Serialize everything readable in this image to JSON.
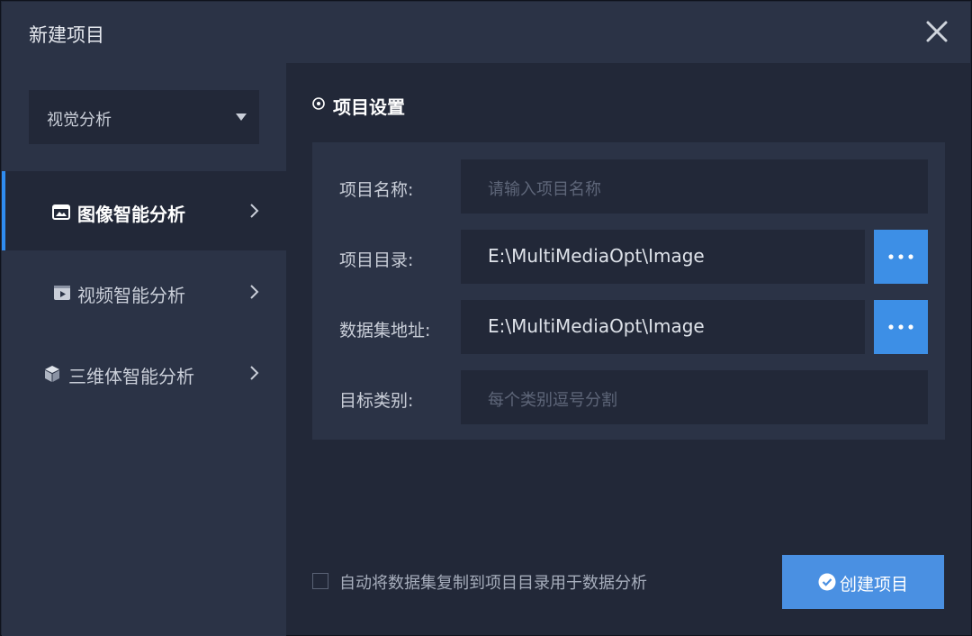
{
  "window": {
    "title": "新建项目"
  },
  "sidebar": {
    "category_select": "视觉分析",
    "items": [
      {
        "label": "图像智能分析",
        "active": true
      },
      {
        "label": "视频智能分析",
        "active": false
      },
      {
        "label": "三维体智能分析",
        "active": false
      }
    ]
  },
  "main": {
    "section_title": "项目设置",
    "fields": {
      "project_name": {
        "label": "项目名称:",
        "value": "",
        "placeholder": "请输入项目名称"
      },
      "project_dir": {
        "label": "项目目录:",
        "value": "E:\\MultiMediaOpt\\Image"
      },
      "dataset_path": {
        "label": "数据集地址:",
        "value": "E:\\MultiMediaOpt\\Image"
      },
      "target_classes": {
        "label": "目标类别:",
        "value": "",
        "placeholder": "每个类别逗号分割"
      }
    },
    "copy_checkbox": {
      "label": "自动将数据集复制到项目目录用于数据分析",
      "checked": false
    },
    "create_button": "创建项目"
  },
  "colors": {
    "accent": "#4a90e2",
    "active_indicator": "#2f8cf0",
    "panel_bg": "#2b3346",
    "content_bg": "#222838"
  },
  "icons": {
    "close": "close-icon",
    "caret": "caret-down-icon",
    "image": "image-icon",
    "video": "video-icon",
    "cube": "cube-icon",
    "chevron": "chevron-right-icon",
    "section": "target-circle-icon",
    "browse": "more-dots-icon",
    "confirm": "check-circle-icon"
  }
}
